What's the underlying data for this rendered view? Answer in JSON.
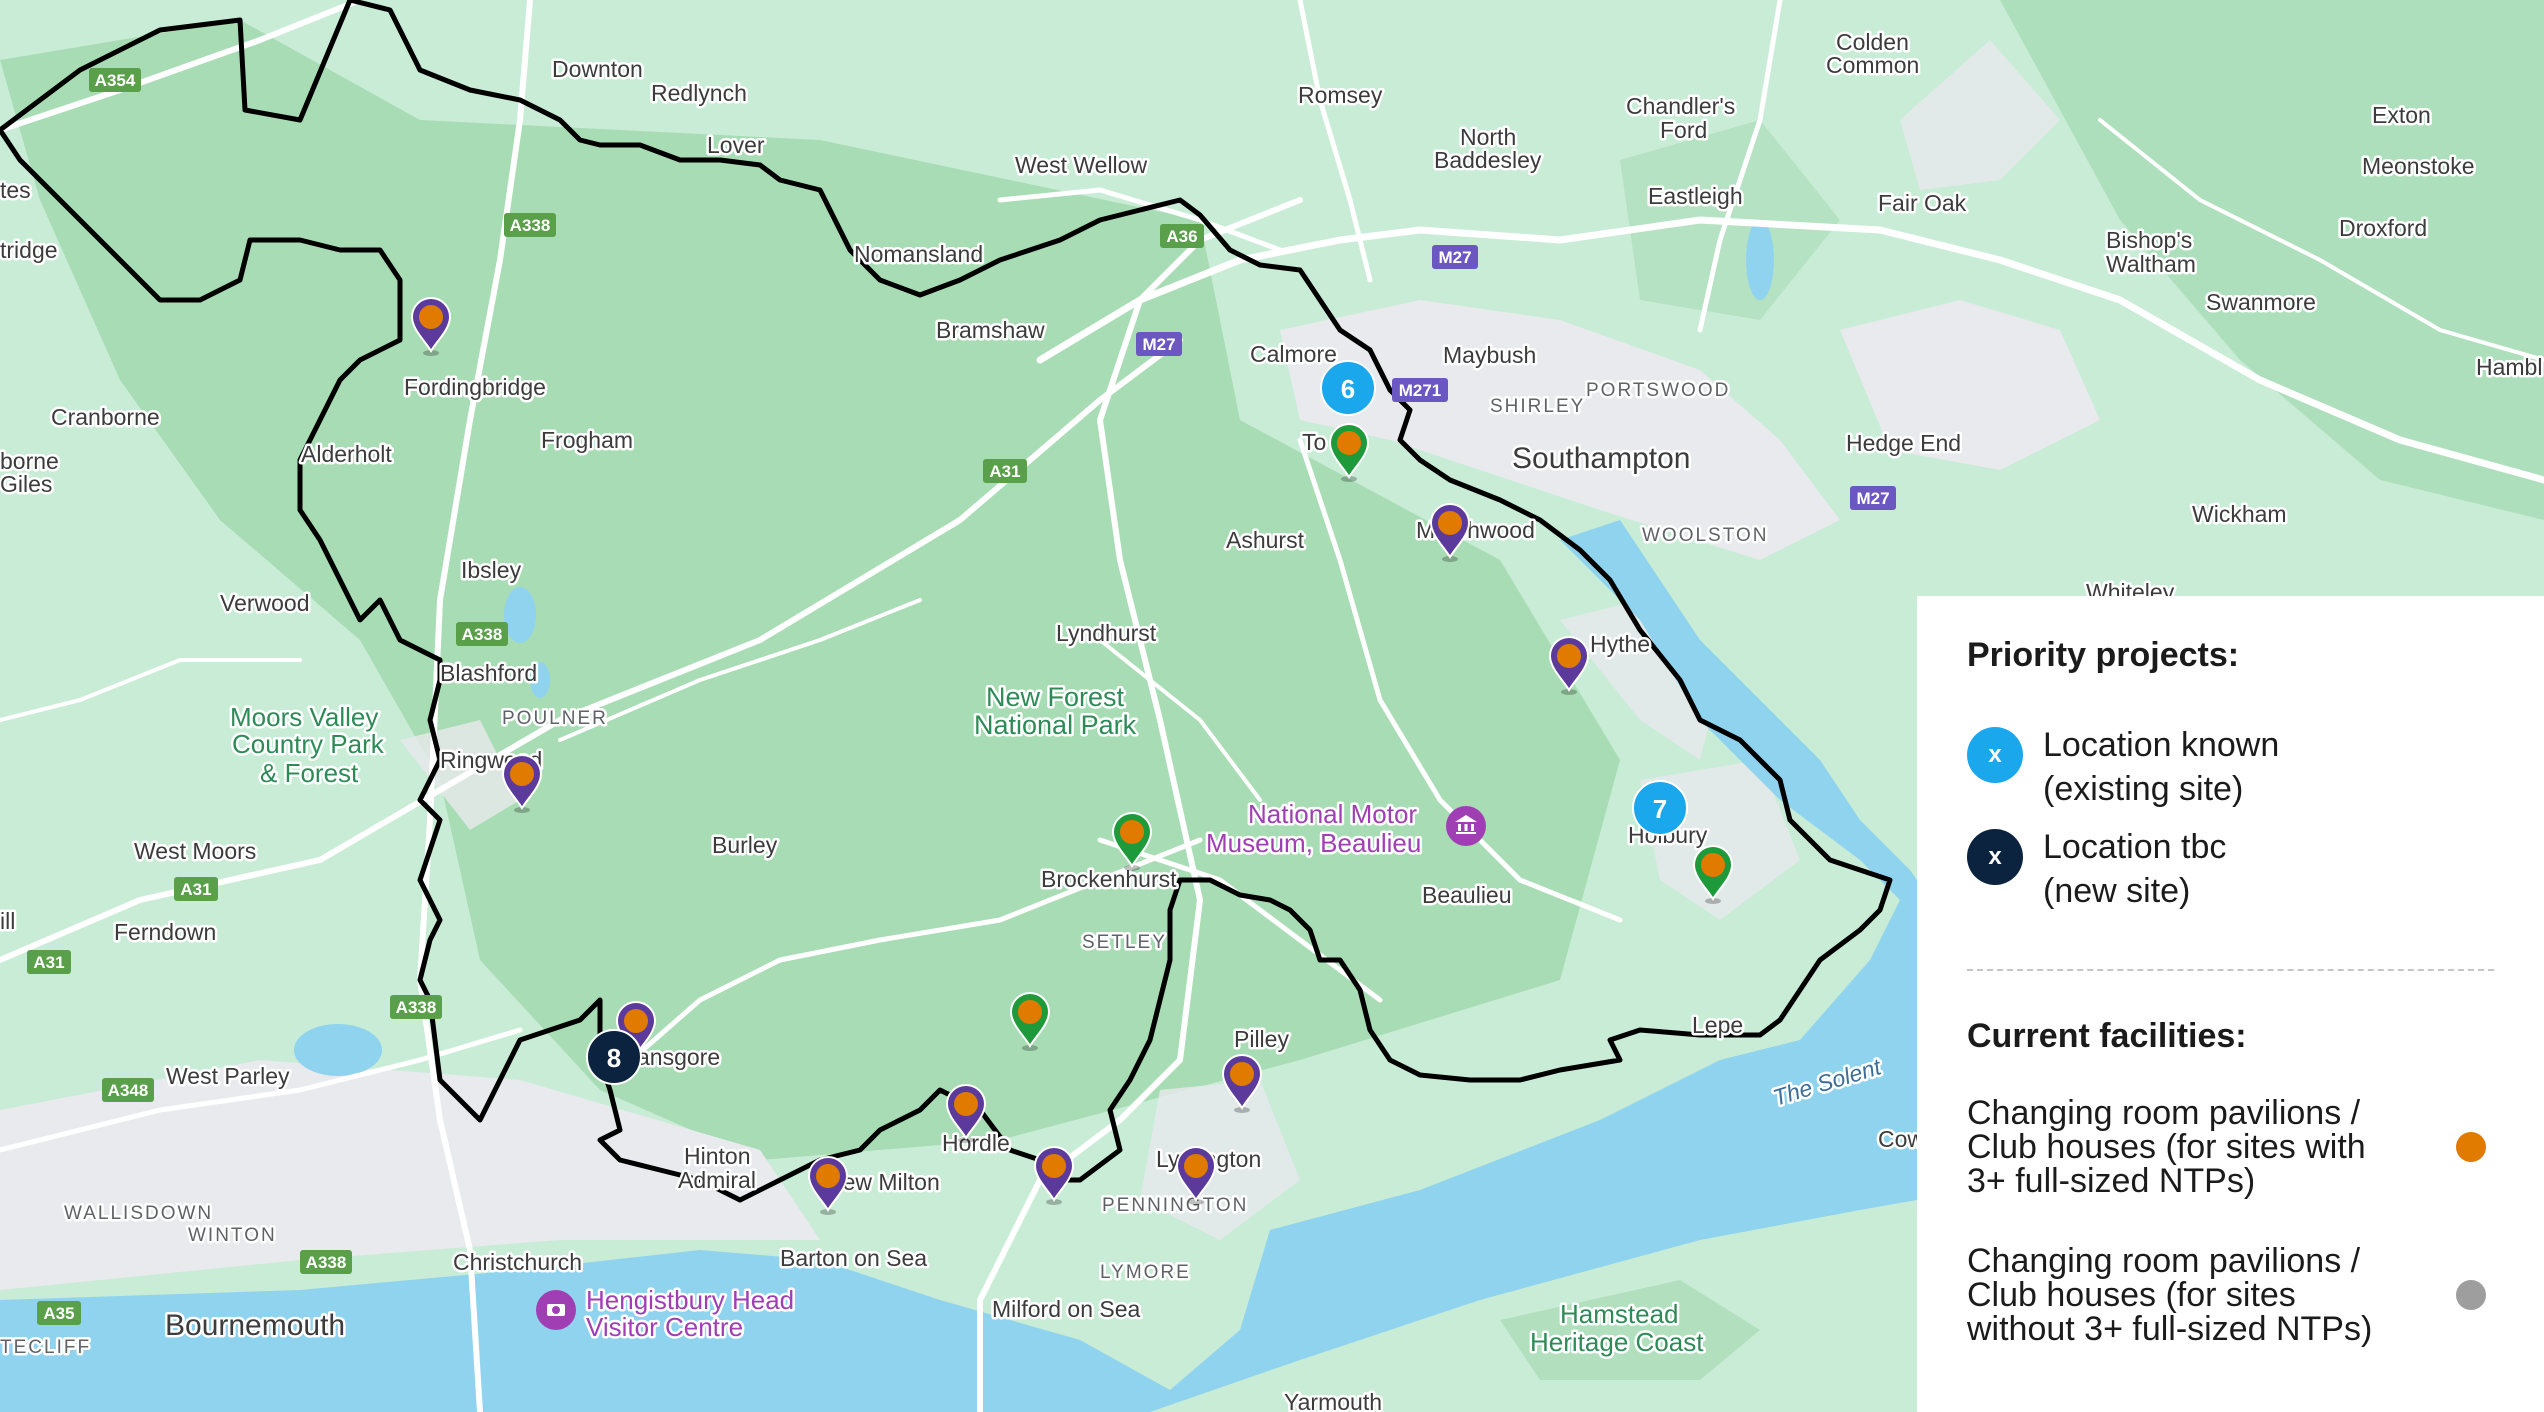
{
  "map": {
    "colors": {
      "land": "#c9ecd6",
      "forest": "#a8dcb5",
      "urban": "#e8eaed",
      "sea": "#8fd3ee",
      "road": "#ffffff",
      "boundary": "#000000",
      "orange": "#e07b00",
      "green_pin": "#1e9a3b",
      "purple_pin": "#5c3a9c",
      "known_project": "#1aa7ec",
      "tbc_project": "#0c2340"
    },
    "places": {
      "downton": "Downton",
      "redlynch": "Redlynch",
      "lover": "Lover",
      "romsey": "Romsey",
      "north": "North",
      "baddesley": "Baddesley",
      "colden": "Colden",
      "common": "Common",
      "chandlers": "Chandler's",
      "ford": "Ford",
      "eastleigh": "Eastleigh",
      "exton": "Exton",
      "meonstoke": "Meonstoke",
      "west_wellow": "West Wellow",
      "fair_oak": "Fair Oak",
      "bishops": "Bishop's",
      "waltham": "Waltham",
      "droxford": "Droxford",
      "nomansland": "Nomansland",
      "swanmore": "Swanmore",
      "tes": "tes",
      "tridge": "tridge",
      "bramshaw": "Bramshaw",
      "calmore": "Calmore",
      "maybush": "Maybush",
      "shirley": "SHIRLEY",
      "portswood": "PORTSWOOD",
      "hambl": "Hambl",
      "fordingbridge": "Fordingbridge",
      "cranborne": "Cranborne",
      "frogham": "Frogham",
      "southampton": "Southampton",
      "hedge_end": "Hedge End",
      "alderholt": "Alderholt",
      "borne": "borne",
      "giles": "Giles",
      "to": "To",
      "ashurst": "Ashurst",
      "marchwood": "Marchwood",
      "woolston": "WOOLSTON",
      "wickham": "Wickham",
      "whiteley": "Whiteley",
      "ibsley": "Ibsley",
      "verwood": "Verwood",
      "lyndhurst": "Lyndhurst",
      "hythe": "Hythe",
      "blashford": "Blashford",
      "poulner": "POULNER",
      "moors_valley_1": "Moors Valley",
      "moors_valley_2": "Country Park",
      "moors_valley_3": "& Forest",
      "new_forest_1": "New Forest",
      "new_forest_2": "National Park",
      "ringwood": "Ringwood",
      "national_motor_1": "National Motor",
      "national_motor_2": "Museum, Beaulieu",
      "holbury": "Holbury",
      "west_moors": "West Moors",
      "burley": "Burley",
      "brockenhurst": "Brockenhurst",
      "beaulieu": "Beaulieu",
      "ill": "ill",
      "ferndown": "Ferndown",
      "setley": "SETLEY",
      "lepe": "Lepe",
      "the_solent": "The Solent",
      "pilley": "Pilley",
      "west_parley": "West Parley",
      "bransgore": "Bransgore",
      "hordle": "Hordle",
      "cow": "Cow",
      "hinton": "Hinton",
      "admiral": "Admiral",
      "new_milton": "New Milton",
      "lymington": "Lymington",
      "pennington": "PENNINGTON",
      "wallisdown": "WALLISDOWN",
      "winton": "WINTON",
      "christchurch": "Christchurch",
      "barton": "Barton on Sea",
      "lymore": "LYMORE",
      "hengistbury_1": "Hengistbury Head",
      "hengistbury_2": "Visitor Centre",
      "milford": "Milford on Sea",
      "hamstead_1": "Hamstead",
      "hamstead_2": "Heritage Coast",
      "bournemouth": "Bournemouth",
      "tecliff": "TECLIFF",
      "yarmouth": "Yarmouth"
    },
    "roads": {
      "a354": "A354",
      "a338_1": "A338",
      "a36": "A36",
      "m27_1": "M27",
      "m27_2": "M27",
      "m271": "M271",
      "m27_3": "M27",
      "a31_1": "A31",
      "a338_2": "A338",
      "a31_2": "A31",
      "a31_3": "A31",
      "a338_3": "A338",
      "a348": "A348",
      "a338_4": "A338",
      "a35": "A35"
    },
    "projects": [
      {
        "label": "6",
        "type": "known"
      },
      {
        "label": "7",
        "type": "known"
      },
      {
        "label": "8",
        "type": "tbc"
      }
    ],
    "facility_pins": [
      {
        "name": "Fordingbridge",
        "color": "purple"
      },
      {
        "name": "Totton",
        "color": "green"
      },
      {
        "name": "Marchwood",
        "color": "purple"
      },
      {
        "name": "Hythe",
        "color": "purple"
      },
      {
        "name": "Ringwood",
        "color": "purple"
      },
      {
        "name": "Brockenhurst",
        "color": "green"
      },
      {
        "name": "Holbury",
        "color": "green"
      },
      {
        "name": "Bransgore",
        "color": "purple"
      },
      {
        "name": "Setley",
        "color": "green"
      },
      {
        "name": "Pilley",
        "color": "purple"
      },
      {
        "name": "Hordle",
        "color": "purple"
      },
      {
        "name": "New Milton",
        "color": "purple"
      },
      {
        "name": "Lymore",
        "color": "purple"
      },
      {
        "name": "Lymington",
        "color": "purple"
      }
    ]
  },
  "legend": {
    "priority_title": "Priority projects:",
    "marker_symbol": "x",
    "known_line1": "Location known",
    "known_line2": "(existing site)",
    "tbc_line1": "Location tbc",
    "tbc_line2": "(new site)",
    "facilities_title": "Current facilities:",
    "facility_with_1": "Changing room pavilions /",
    "facility_with_2": "Club houses (for sites with",
    "facility_with_3": "3+ full-sized NTPs)",
    "facility_without_1": "Changing room pavilions /",
    "facility_without_2": "Club houses (for sites",
    "facility_without_3": "without 3+ full-sized NTPs)",
    "color_with": "#e07b00",
    "color_without": "#9e9e9e",
    "color_known": "#1aa7ec",
    "color_tbc": "#0c2340"
  }
}
